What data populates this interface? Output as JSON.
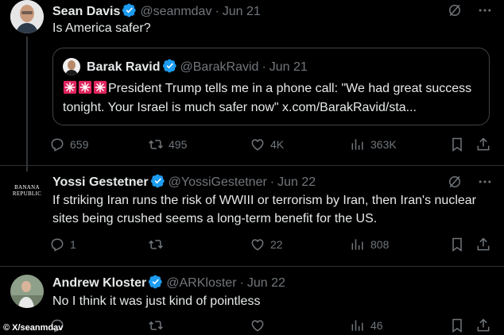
{
  "tweets": [
    {
      "name": "Sean Davis",
      "handle": "@seanmdav",
      "date": "Jun 21",
      "text": "Is America safer?",
      "quote": {
        "name": "Barak Ravid",
        "handle": "@BarakRavid",
        "date": "Jun 21",
        "text": "President Trump tells me in a phone call: \"We had great success tonight. Your Israel is much safer now\" x.com/BarakRavid/sta..."
      },
      "replies": "659",
      "reposts": "495",
      "likes": "4K",
      "views": "363K"
    },
    {
      "avatar_text": "BANANA REPUBLIC",
      "name": "Yossi Gestetner",
      "handle": "@YossiGestetner",
      "date": "Jun 22",
      "text": "If striking Iran runs the risk of WWIII or terrorism by Iran, then Iran's nuclear sites being crushed seems a long-term benefit for the US.",
      "replies": "1",
      "reposts": "",
      "likes": "22",
      "views": "808"
    },
    {
      "name": "Andrew Kloster",
      "handle": "@ARKloster",
      "date": "Jun 22",
      "text": "No I think it was just kind of pointless",
      "replies": "",
      "reposts": "",
      "likes": "",
      "views": "46"
    }
  ],
  "separator": "·",
  "watermark": "© X/seanmdav",
  "colors": {
    "background": "#000000",
    "verified": "#1d9bf0",
    "muted": "#71767b"
  }
}
